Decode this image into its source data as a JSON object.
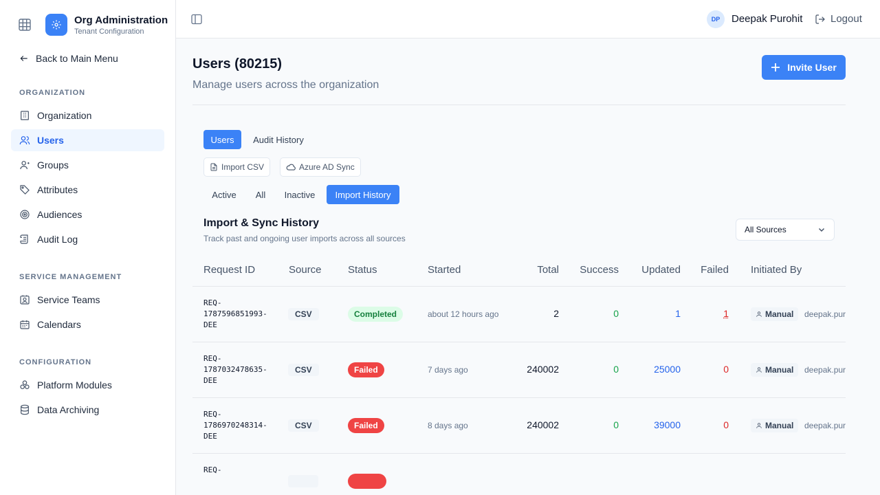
{
  "sidebar": {
    "brand_title": "Org Administration",
    "brand_subtitle": "Tenant Configuration",
    "back_label": "Back to Main Menu",
    "sections": [
      {
        "label": "ORGANIZATION",
        "items": [
          {
            "label": "Organization",
            "icon": "building-icon"
          },
          {
            "label": "Users",
            "icon": "users-icon",
            "active": true
          },
          {
            "label": "Groups",
            "icon": "group-icon"
          },
          {
            "label": "Attributes",
            "icon": "tag-icon"
          },
          {
            "label": "Audiences",
            "icon": "target-icon"
          },
          {
            "label": "Audit Log",
            "icon": "scroll-icon"
          }
        ]
      },
      {
        "label": "SERVICE MANAGEMENT",
        "items": [
          {
            "label": "Service Teams",
            "icon": "contact-icon"
          },
          {
            "label": "Calendars",
            "icon": "calendar-icon"
          }
        ]
      },
      {
        "label": "CONFIGURATION",
        "items": [
          {
            "label": "Platform Modules",
            "icon": "modules-icon"
          },
          {
            "label": "Data Archiving",
            "icon": "database-icon"
          }
        ]
      }
    ]
  },
  "topbar": {
    "avatar_initials": "DP",
    "user_name": "Deepak Purohit",
    "logout_label": "Logout"
  },
  "page": {
    "title": "Users (80215)",
    "subtitle": "Manage users across the organization",
    "invite_label": "Invite User"
  },
  "tabs": {
    "primary": [
      {
        "label": "Users",
        "active": true
      },
      {
        "label": "Audit History",
        "active": false
      }
    ],
    "actions": [
      {
        "label": "Import CSV",
        "icon": "file-icon"
      },
      {
        "label": "Azure AD Sync",
        "icon": "cloud-icon"
      }
    ],
    "filters": [
      {
        "label": "Active",
        "active": false
      },
      {
        "label": "All",
        "active": false
      },
      {
        "label": "Inactive",
        "active": false
      },
      {
        "label": "Import History",
        "active": true
      }
    ]
  },
  "history": {
    "title": "Import & Sync History",
    "subtitle": "Track past and ongoing user imports across all sources",
    "source_filter": "All Sources",
    "columns": [
      "Request ID",
      "Source",
      "Status",
      "Started",
      "Total",
      "Success",
      "Updated",
      "Failed",
      "Initiated By"
    ],
    "rows": [
      {
        "request_id": [
          "REQ-",
          "1787596851993-",
          "DEE"
        ],
        "source": "CSV",
        "status": "Completed",
        "started": "about 12 hours ago",
        "total": "2",
        "success": "0",
        "updated": "1",
        "failed": "1",
        "initiated": "Manual",
        "email": "deepak.purohit"
      },
      {
        "request_id": [
          "REQ-",
          "1787032478635-",
          "DEE"
        ],
        "source": "CSV",
        "status": "Failed",
        "started": "7 days ago",
        "total": "240002",
        "success": "0",
        "updated": "25000",
        "failed": "0",
        "initiated": "Manual",
        "email": "deepak.purohit"
      },
      {
        "request_id": [
          "REQ-",
          "1786970248314-",
          "DEE"
        ],
        "source": "CSV",
        "status": "Failed",
        "started": "8 days ago",
        "total": "240002",
        "success": "0",
        "updated": "39000",
        "failed": "0",
        "initiated": "Manual",
        "email": "deepak.purohit"
      },
      {
        "request_id": [
          "REQ-"
        ],
        "source": "",
        "status": "",
        "started": "",
        "total": "",
        "success": "",
        "updated": "",
        "failed": "",
        "initiated": "",
        "email": ""
      }
    ]
  },
  "colors": {
    "accent": "#3b82f6",
    "success": "#16a34a",
    "updated": "#2563eb",
    "failed": "#dc2626"
  }
}
